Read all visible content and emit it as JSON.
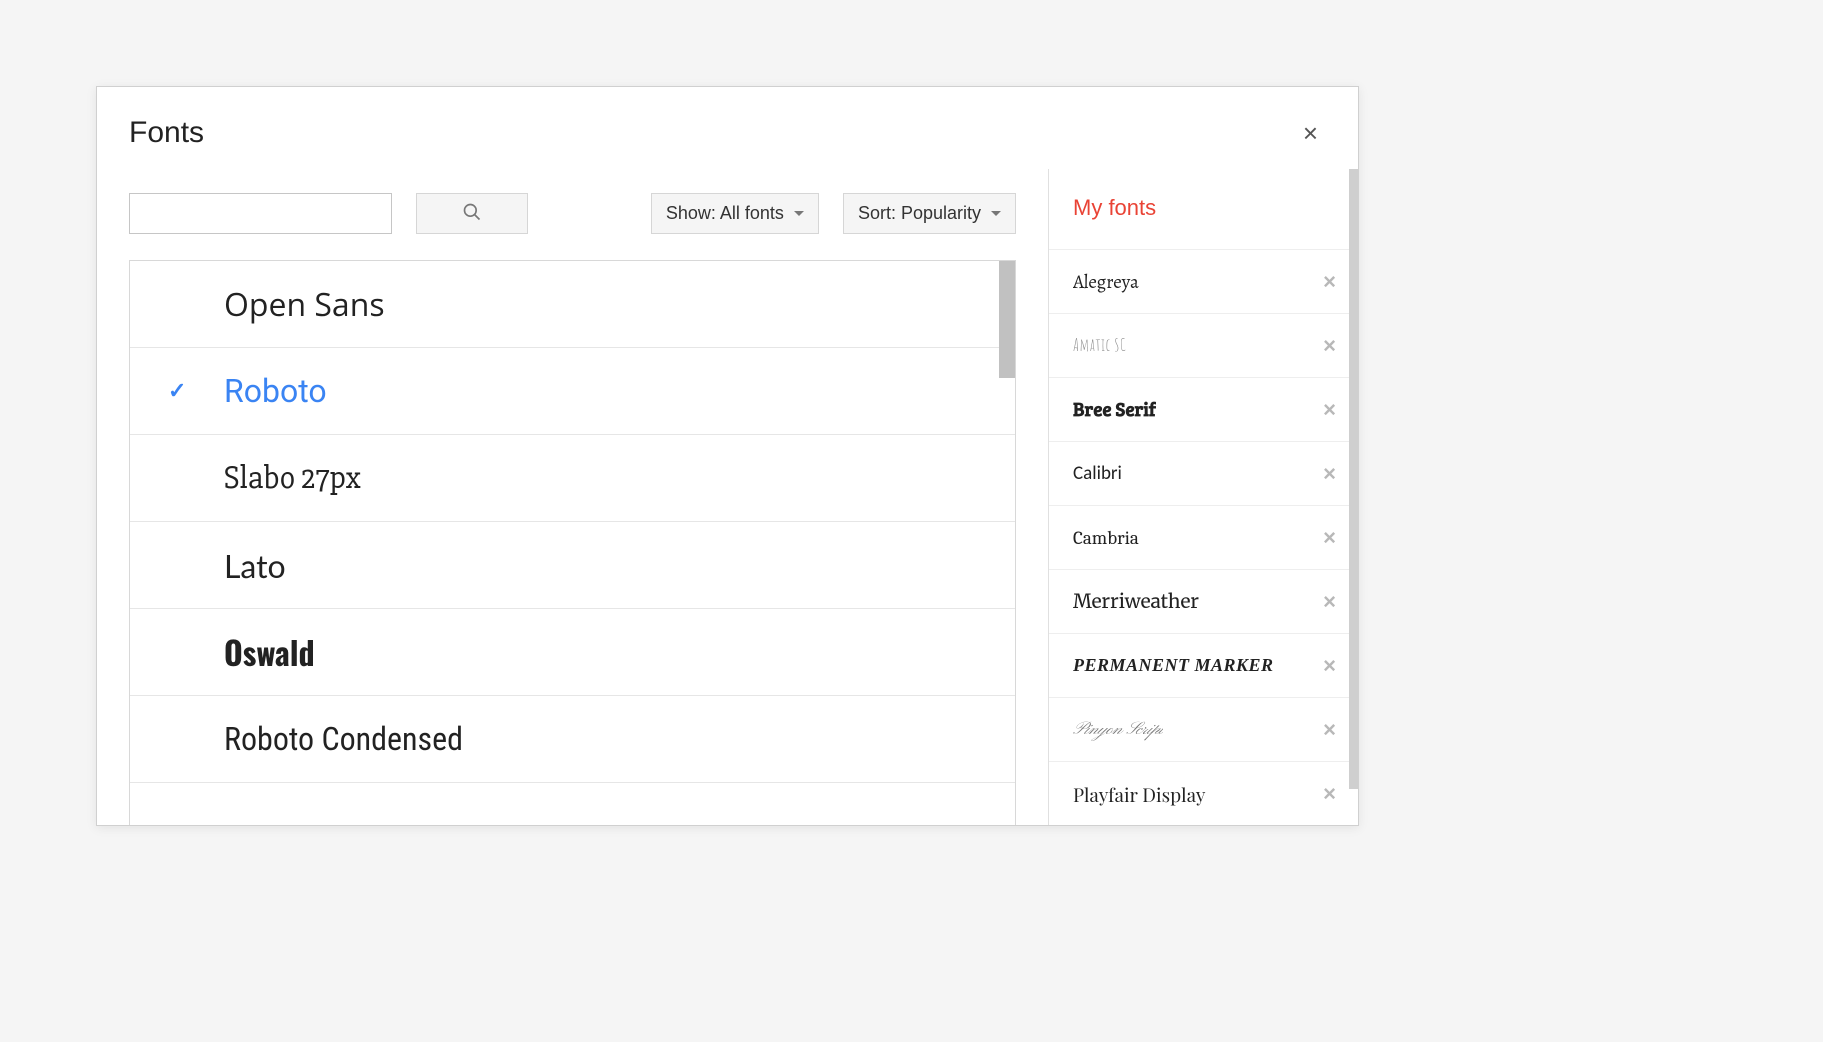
{
  "dialog": {
    "title": "Fonts",
    "close_label": "×"
  },
  "controls": {
    "search_value": "",
    "show_label": "Show: All fonts",
    "sort_label": "Sort: Popularity"
  },
  "font_list": [
    {
      "name": "Open Sans",
      "selected": false,
      "style_class": "f-opensans"
    },
    {
      "name": "Roboto",
      "selected": true,
      "style_class": "f-roboto"
    },
    {
      "name": "Slabo 27px",
      "selected": false,
      "style_class": "f-slabo"
    },
    {
      "name": "Lato",
      "selected": false,
      "style_class": "f-lato"
    },
    {
      "name": "Oswald",
      "selected": false,
      "style_class": "f-oswald"
    },
    {
      "name": "Roboto Condensed",
      "selected": false,
      "style_class": "f-robotocond"
    }
  ],
  "sidebar": {
    "heading": "My fonts",
    "items": [
      {
        "name": "Alegreya",
        "style_class": "mf-alegreya"
      },
      {
        "name": "Amatic SC",
        "style_class": "mf-amatic"
      },
      {
        "name": "Bree Serif",
        "style_class": "mf-bree"
      },
      {
        "name": "Calibri",
        "style_class": "mf-calibri"
      },
      {
        "name": "Cambria",
        "style_class": "mf-cambria"
      },
      {
        "name": "Merriweather",
        "style_class": "mf-merri"
      },
      {
        "name": "Permanent Marker",
        "style_class": "mf-permmarker"
      },
      {
        "name": "Pinyon Script",
        "style_class": "mf-pinyon"
      },
      {
        "name": "Playfair Display",
        "style_class": "mf-playfair"
      }
    ],
    "remove_label": "×"
  }
}
